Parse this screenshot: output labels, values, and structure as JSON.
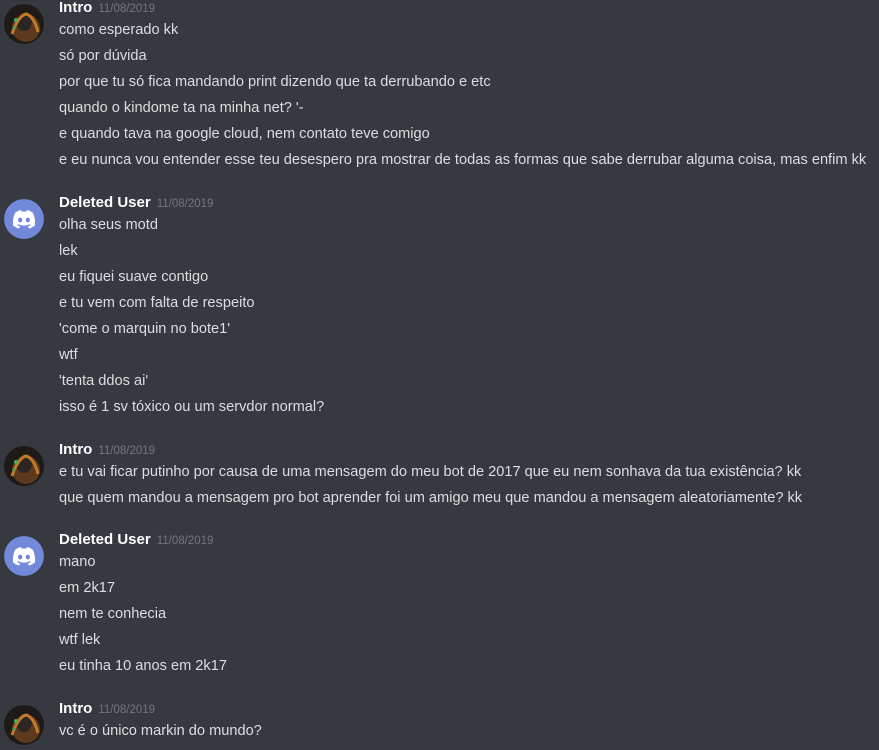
{
  "colors": {
    "background": "#36393f",
    "username": "#ffffff",
    "timestamp": "#72767d",
    "message_text": "#dcddde",
    "discord_blurple": "#7289da"
  },
  "messages": [
    {
      "author": "Intro",
      "timestamp": "11/08/2019",
      "avatar": "user-avatar-dark",
      "lines": [
        "como esperado kk",
        "só por dúvida",
        "por que tu só fica mandando print dizendo que ta derrubando e etc",
        "quando o kindome ta na minha net? '-",
        "e quando tava na google cloud, nem contato teve comigo",
        "e eu nunca vou entender esse teu desespero pra mostrar de todas as formas que sabe derrubar alguma coisa, mas enfim kk"
      ]
    },
    {
      "author": "Deleted User",
      "timestamp": "11/08/2019",
      "avatar": "discord-logo-avatar",
      "lines": [
        "olha seus motd",
        "lek",
        "eu fiquei suave contigo",
        "e tu vem com falta de respeito",
        "'come o marquin no bote1'",
        "wtf",
        "'tenta ddos ai'",
        "isso é 1 sv tóxico ou um servdor normal?"
      ]
    },
    {
      "author": "Intro",
      "timestamp": "11/08/2019",
      "avatar": "user-avatar-dark",
      "lines": [
        "e tu vai ficar putinho por causa de uma mensagem do meu bot de 2017 que eu nem sonhava da tua existência? kk",
        "que quem mandou a mensagem pro bot aprender foi um amigo meu que mandou a mensagem aleatoriamente? kk"
      ]
    },
    {
      "author": "Deleted User",
      "timestamp": "11/08/2019",
      "avatar": "discord-logo-avatar",
      "lines": [
        "mano",
        "em 2k17",
        "nem te conhecia",
        "wtf lek",
        "eu tinha 10 anos em 2k17"
      ]
    },
    {
      "author": "Intro",
      "timestamp": "11/08/2019",
      "avatar": "user-avatar-dark",
      "lines": [
        "vc é o único markin do mundo?"
      ]
    }
  ]
}
